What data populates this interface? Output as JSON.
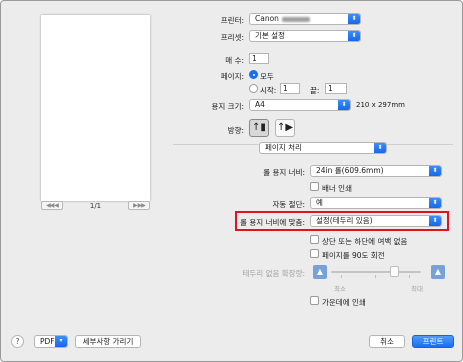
{
  "printer": {
    "label": "프린터:",
    "value": "Canon"
  },
  "presets": {
    "label": "프리셋:",
    "value": "기본 설정"
  },
  "copies": {
    "label": "매 수:",
    "value": "1"
  },
  "pages": {
    "label": "페이지:",
    "all_label": "모두",
    "from_label": "시작:",
    "from_value": "1",
    "to_label": "끝:",
    "to_value": "1"
  },
  "paper_size": {
    "label": "용지 크기:",
    "value": "A4",
    "dimensions": "210 x 297mm"
  },
  "orientation": {
    "label": "방향:"
  },
  "section": {
    "value": "페이지 처리"
  },
  "roll_width": {
    "label": "롤 용지 너비:",
    "value": "24in 롤(609.6mm)"
  },
  "banner": {
    "label": "배너 인쇄"
  },
  "auto_cut": {
    "label": "자동 절단:",
    "value": "예"
  },
  "fit_roll": {
    "label": "롤 용지 너비에 맞춤:",
    "value": "설정(테두리 있음)"
  },
  "no_margin": {
    "label": "상단 또는 하단에 여백 없음"
  },
  "rotate90": {
    "label": "페이지를 90도 회전"
  },
  "borderless_ext": {
    "label": "테두리 없음 확장량:",
    "min_label": "최소",
    "max_label": "최대",
    "level": 0.7
  },
  "center_print": {
    "label": "가운데에 인쇄"
  },
  "preview_pager": {
    "prev": "◀◀  ◀",
    "next": "▶  ▶▶",
    "page": "1/1"
  },
  "footer": {
    "help": "?",
    "pdf_label": "PDF",
    "hide_details": "세부사항 가리기",
    "cancel": "취소",
    "print": "프린트"
  },
  "colors": {
    "accent": "#1a6cf0",
    "highlight": "#e0141e"
  }
}
